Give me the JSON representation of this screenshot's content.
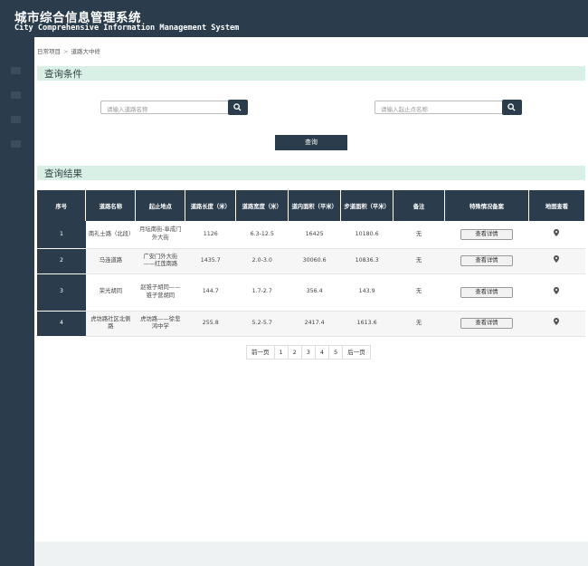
{
  "app": {
    "title": "城市综合信息管理系统",
    "subtitle": "City Comprehensive Information Management System"
  },
  "breadcrumb": {
    "items": [
      "日常项目",
      "道路大中修"
    ],
    "separator": ">"
  },
  "query_section": {
    "title": "查询条件",
    "road_name_placeholder": "请输入道路名称",
    "location_placeholder": "请输入起止点名称",
    "query_button": "查询"
  },
  "results_section": {
    "title": "查询结果",
    "columns": [
      "序号",
      "道路名称",
      "起止地点",
      "道路长度（米）",
      "道路宽度（米）",
      "道内面积（平米）",
      "步道面积（平米）",
      "备注",
      "特殊情况备案",
      "地图查看"
    ],
    "rows": [
      {
        "index": "1",
        "road": "南礼士路（北段）",
        "location": "月坛南街-阜成门外大街",
        "length": "1126",
        "width": "6.3-12.5",
        "inner_area": "16425",
        "walk_area": "10180.6",
        "note": "无",
        "detail": "查看详情"
      },
      {
        "index": "2",
        "road": "马连道路",
        "location": "广安门外大街——红莲南路",
        "length": "1435.7",
        "width": "2.0-3.0",
        "inner_area": "30060.6",
        "walk_area": "10836.3",
        "note": "无",
        "detail": "查看详情"
      },
      {
        "index": "3",
        "road": "荣光胡同",
        "location": "赵锥子胡同——锥子营胡同",
        "length": "144.7",
        "width": "1.7-2.7",
        "inner_area": "356.4",
        "walk_area": "143.9",
        "note": "无",
        "detail": "查看详情"
      },
      {
        "index": "4",
        "road": "虎坊路社区北侧路",
        "location": "虎坊路——徐悲鸿中学",
        "length": "255.8",
        "width": "5.2-5.7",
        "inner_area": "2417.4",
        "walk_area": "1613.6",
        "note": "无",
        "detail": "查看详情"
      }
    ]
  },
  "pagination": {
    "prev": "前一页",
    "pages": [
      "1",
      "2",
      "3",
      "4",
      "5"
    ],
    "next": "后一页"
  },
  "icons": {
    "search": "search-icon",
    "map": "map-pin-icon"
  },
  "colors": {
    "primary": "#2b3d4d",
    "section_bg": "#d8f0e6"
  }
}
